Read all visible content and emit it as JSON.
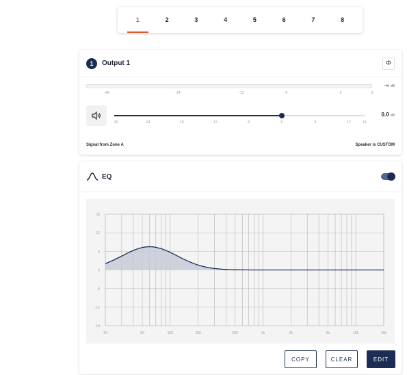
{
  "tabs": [
    {
      "label": "1",
      "active": true
    },
    {
      "label": "2",
      "active": false
    },
    {
      "label": "3",
      "active": false
    },
    {
      "label": "4",
      "active": false
    },
    {
      "label": "5",
      "active": false
    },
    {
      "label": "6",
      "active": false
    },
    {
      "label": "7",
      "active": false
    },
    {
      "label": "8",
      "active": false
    }
  ],
  "output": {
    "number": "1",
    "title": "Output 1",
    "phase_icon": "Φ",
    "meter_value": "-∞",
    "meter_unit": "dB",
    "meter_scale": [
      "-48",
      "-24",
      "-12",
      "-6",
      "0",
      "3"
    ],
    "volume_value": "0.0",
    "volume_unit": "dB",
    "volume_level": 0.67,
    "volume_scale": [
      "-30",
      "-24",
      "-18",
      "-12",
      "-6",
      "0",
      "6",
      "12",
      "15"
    ],
    "signal_text": "Signal from Zone A",
    "speaker_text": "Speaker is CUSTOM"
  },
  "eq": {
    "title": "EQ",
    "enabled": true,
    "y_labels": [
      "18",
      "12",
      "6",
      "0",
      "-6",
      "-12",
      "-18"
    ],
    "x_labels": [
      "20",
      "50",
      "100",
      "200",
      "500",
      "1k",
      "2k",
      "5k",
      "10k",
      "20k"
    ]
  },
  "buttons": {
    "copy": "COPY",
    "clear": "CLEAR",
    "edit": "EDIT"
  },
  "colors": {
    "accent": "#e4572e",
    "navy": "#1c2d55",
    "curve_fill": "#c5cbd8"
  }
}
